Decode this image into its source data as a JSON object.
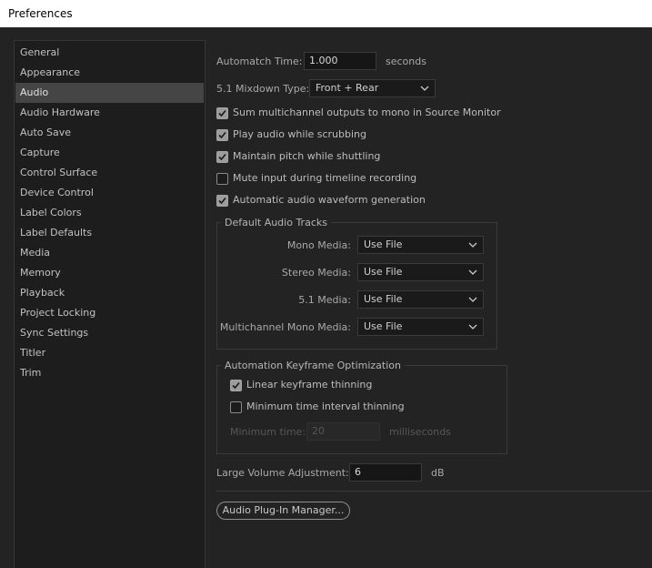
{
  "window": {
    "title": "Preferences"
  },
  "sidebar": {
    "items": [
      {
        "label": "General"
      },
      {
        "label": "Appearance"
      },
      {
        "label": "Audio"
      },
      {
        "label": "Audio Hardware"
      },
      {
        "label": "Auto Save"
      },
      {
        "label": "Capture"
      },
      {
        "label": "Control Surface"
      },
      {
        "label": "Device Control"
      },
      {
        "label": "Label Colors"
      },
      {
        "label": "Label Defaults"
      },
      {
        "label": "Media"
      },
      {
        "label": "Memory"
      },
      {
        "label": "Playback"
      },
      {
        "label": "Project Locking"
      },
      {
        "label": "Sync Settings"
      },
      {
        "label": "Titler"
      },
      {
        "label": "Trim"
      }
    ],
    "active": "Audio"
  },
  "audio": {
    "automatch_label": "Automatch Time:",
    "automatch_value": "1.000",
    "automatch_unit": "seconds",
    "mixdown_label": "5.1 Mixdown Type:",
    "mixdown_value": "Front + Rear",
    "checkboxes": [
      {
        "label": "Sum multichannel outputs to mono in Source Monitor",
        "checked": true
      },
      {
        "label": "Play audio while scrubbing",
        "checked": true
      },
      {
        "label": "Maintain pitch while shuttling",
        "checked": true
      },
      {
        "label": "Mute input during timeline recording",
        "checked": false
      },
      {
        "label": "Automatic audio waveform generation",
        "checked": true
      }
    ],
    "default_tracks": {
      "title": "Default Audio Tracks",
      "rows": [
        {
          "label": "Mono Media:",
          "value": "Use File"
        },
        {
          "label": "Stereo Media:",
          "value": "Use File"
        },
        {
          "label": "5.1 Media:",
          "value": "Use File"
        },
        {
          "label": "Multichannel Mono Media:",
          "value": "Use File"
        }
      ]
    },
    "keyframe_opt": {
      "title": "Automation Keyframe Optimization",
      "linear_label": "Linear keyframe thinning",
      "linear_checked": true,
      "min_interval_label": "Minimum time interval thinning",
      "min_interval_checked": false,
      "min_time_label": "Minimum time:",
      "min_time_value": "20",
      "min_time_unit": "milliseconds"
    },
    "large_volume_label": "Large Volume Adjustment:",
    "large_volume_value": "6",
    "large_volume_unit": "dB",
    "plugin_manager_label": "Audio Plug-In Manager..."
  }
}
